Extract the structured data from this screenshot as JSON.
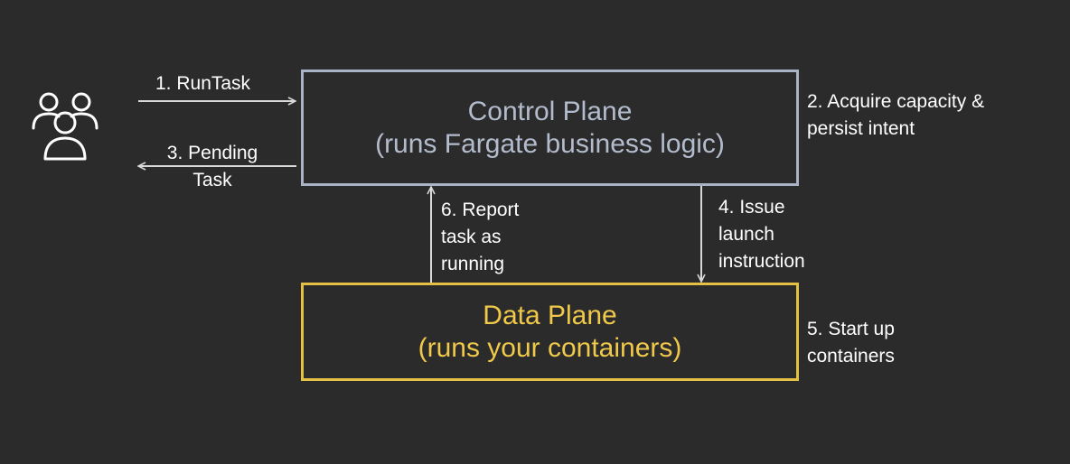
{
  "control_plane": {
    "title": "Control Plane",
    "subtitle": "(runs Fargate business logic)",
    "color": "#aab3c6"
  },
  "data_plane": {
    "title": "Data Plane",
    "subtitle": "(runs your containers)",
    "color": "#e2c144"
  },
  "steps": {
    "run_task": "1. RunTask",
    "acquire": "2. Acquire capacity &\npersist intent",
    "pending": "3. Pending\nTask",
    "issue": "4. Issue\nlaunch\ninstruction",
    "start_up": "5. Start up\ncontainers",
    "report": "6. Report\ntask as\nrunning"
  },
  "icons": {
    "users": "users-icon"
  },
  "colors": {
    "background": "#2b2b2b",
    "arrow": "#d9d9d9"
  }
}
